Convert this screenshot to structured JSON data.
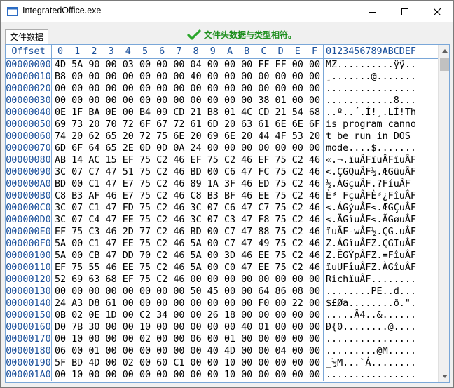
{
  "window": {
    "title": "IntegratedOffice.exe",
    "controls": {
      "minimize": "minimize-icon",
      "maximize": "maximize-icon",
      "close": "close-icon"
    }
  },
  "toolbar": {
    "tab_label": "文件数据",
    "status_text": "文件头数据与类型相符。",
    "status_icon": "checkmark-icon",
    "status_color": "#1f8f1f"
  },
  "hex_view": {
    "header": {
      "offset_label": "Offset",
      "columns": [
        "0",
        "1",
        "2",
        "3",
        "4",
        "5",
        "6",
        "7",
        "8",
        "9",
        "A",
        "B",
        "C",
        "D",
        "E",
        "F"
      ],
      "ascii_label": "0123456789ABCDEF"
    },
    "rows": [
      {
        "offset": "00000000",
        "bytes": [
          "4D",
          "5A",
          "90",
          "00",
          "03",
          "00",
          "00",
          "00",
          "04",
          "00",
          "00",
          "00",
          "FF",
          "FF",
          "00",
          "00"
        ],
        "ascii": "MZ..........ÿÿ.."
      },
      {
        "offset": "00000010",
        "bytes": [
          "B8",
          "00",
          "00",
          "00",
          "00",
          "00",
          "00",
          "00",
          "40",
          "00",
          "00",
          "00",
          "00",
          "00",
          "00",
          "00"
        ],
        "ascii": "¸.......@......."
      },
      {
        "offset": "00000020",
        "bytes": [
          "00",
          "00",
          "00",
          "00",
          "00",
          "00",
          "00",
          "00",
          "00",
          "00",
          "00",
          "00",
          "00",
          "00",
          "00",
          "00"
        ],
        "ascii": "................"
      },
      {
        "offset": "00000030",
        "bytes": [
          "00",
          "00",
          "00",
          "00",
          "00",
          "00",
          "00",
          "00",
          "00",
          "00",
          "00",
          "00",
          "38",
          "01",
          "00",
          "00"
        ],
        "ascii": "............8..."
      },
      {
        "offset": "00000040",
        "bytes": [
          "0E",
          "1F",
          "BA",
          "0E",
          "00",
          "B4",
          "09",
          "CD",
          "21",
          "B8",
          "01",
          "4C",
          "CD",
          "21",
          "54",
          "68"
        ],
        "ascii": "..º..´.Í!¸.LÍ!Th"
      },
      {
        "offset": "00000050",
        "bytes": [
          "69",
          "73",
          "20",
          "70",
          "72",
          "6F",
          "67",
          "72",
          "61",
          "6D",
          "20",
          "63",
          "61",
          "6E",
          "6E",
          "6F"
        ],
        "ascii": "is program canno"
      },
      {
        "offset": "00000060",
        "bytes": [
          "74",
          "20",
          "62",
          "65",
          "20",
          "72",
          "75",
          "6E",
          "20",
          "69",
          "6E",
          "20",
          "44",
          "4F",
          "53",
          "20"
        ],
        "ascii": "t be run in DOS "
      },
      {
        "offset": "00000070",
        "bytes": [
          "6D",
          "6F",
          "64",
          "65",
          "2E",
          "0D",
          "0D",
          "0A",
          "24",
          "00",
          "00",
          "00",
          "00",
          "00",
          "00",
          "00"
        ],
        "ascii": "mode....$......."
      },
      {
        "offset": "00000080",
        "bytes": [
          "AB",
          "14",
          "AC",
          "15",
          "EF",
          "75",
          "C2",
          "46",
          "EF",
          "75",
          "C2",
          "46",
          "EF",
          "75",
          "C2",
          "46"
        ],
        "ascii": "«.¬.ïuÂFïuÂFïuÂF"
      },
      {
        "offset": "00000090",
        "bytes": [
          "3C",
          "07",
          "C7",
          "47",
          "51",
          "75",
          "C2",
          "46",
          "BD",
          "00",
          "C6",
          "47",
          "FC",
          "75",
          "C2",
          "46"
        ],
        "ascii": "<.ÇGQuÂF½.ÆGüuÂF"
      },
      {
        "offset": "000000A0",
        "bytes": [
          "BD",
          "00",
          "C1",
          "47",
          "E7",
          "75",
          "C2",
          "46",
          "89",
          "1A",
          "3F",
          "46",
          "ED",
          "75",
          "C2",
          "46"
        ],
        "ascii": "½.ÁGçuÂF.?FíuÂF"
      },
      {
        "offset": "000000B0",
        "bytes": [
          "C8",
          "B3",
          "AF",
          "46",
          "E7",
          "75",
          "C2",
          "46",
          "C8",
          "B3",
          "BF",
          "46",
          "EE",
          "75",
          "C2",
          "46"
        ],
        "ascii": "È³¯FçuÂFÈ³¿FîuÂF"
      },
      {
        "offset": "000000C0",
        "bytes": [
          "3C",
          "07",
          "C1",
          "47",
          "FD",
          "75",
          "C2",
          "46",
          "3C",
          "07",
          "C6",
          "47",
          "C7",
          "75",
          "C2",
          "46"
        ],
        "ascii": "<.ÁGýuÂF<.ÆGÇuÂF"
      },
      {
        "offset": "000000D0",
        "bytes": [
          "3C",
          "07",
          "C4",
          "47",
          "EE",
          "75",
          "C2",
          "46",
          "3C",
          "07",
          "C3",
          "47",
          "F8",
          "75",
          "C2",
          "46"
        ],
        "ascii": "<.ÄGîuÂF<.ÃGøuÂF"
      },
      {
        "offset": "000000E0",
        "bytes": [
          "EF",
          "75",
          "C3",
          "46",
          "2D",
          "77",
          "C2",
          "46",
          "BD",
          "00",
          "C7",
          "47",
          "88",
          "75",
          "C2",
          "46"
        ],
        "ascii": "ïuÃF-wÂF½.ÇG.uÂF"
      },
      {
        "offset": "000000F0",
        "bytes": [
          "5A",
          "00",
          "C1",
          "47",
          "EE",
          "75",
          "C2",
          "46",
          "5A",
          "00",
          "C7",
          "47",
          "49",
          "75",
          "C2",
          "46"
        ],
        "ascii": "Z.ÁGîuÂFZ.ÇGIuÂF"
      },
      {
        "offset": "00000100",
        "bytes": [
          "5A",
          "00",
          "CB",
          "47",
          "DD",
          "70",
          "C2",
          "46",
          "5A",
          "00",
          "3D",
          "46",
          "EE",
          "75",
          "C2",
          "46"
        ],
        "ascii": "Z.ËGÝpÂFZ.=FîuÂF"
      },
      {
        "offset": "00000110",
        "bytes": [
          "EF",
          "75",
          "55",
          "46",
          "EE",
          "75",
          "C2",
          "46",
          "5A",
          "00",
          "C0",
          "47",
          "EE",
          "75",
          "C2",
          "46"
        ],
        "ascii": "ïuUFîuÂFZ.ÀGîuÂF"
      },
      {
        "offset": "00000120",
        "bytes": [
          "52",
          "69",
          "63",
          "68",
          "EF",
          "75",
          "C2",
          "46",
          "00",
          "00",
          "00",
          "00",
          "00",
          "00",
          "00",
          "00"
        ],
        "ascii": "RichïuÂF........"
      },
      {
        "offset": "00000130",
        "bytes": [
          "00",
          "00",
          "00",
          "00",
          "00",
          "00",
          "00",
          "00",
          "50",
          "45",
          "00",
          "00",
          "64",
          "86",
          "08",
          "00"
        ],
        "ascii": "........PE..d..."
      },
      {
        "offset": "00000140",
        "bytes": [
          "24",
          "A3",
          "D8",
          "61",
          "00",
          "00",
          "00",
          "00",
          "00",
          "00",
          "00",
          "00",
          "F0",
          "00",
          "22",
          "00"
        ],
        "ascii": "$£Øa........ð.\"."
      },
      {
        "offset": "00000150",
        "bytes": [
          "0B",
          "02",
          "0E",
          "1D",
          "00",
          "C2",
          "34",
          "00",
          "00",
          "26",
          "18",
          "00",
          "00",
          "00",
          "00",
          "00"
        ],
        "ascii": ".....Â4..&......"
      },
      {
        "offset": "00000160",
        "bytes": [
          "D0",
          "7B",
          "30",
          "00",
          "00",
          "10",
          "00",
          "00",
          "00",
          "00",
          "00",
          "40",
          "01",
          "00",
          "00",
          "00"
        ],
        "ascii": "Ð{0........@...."
      },
      {
        "offset": "00000170",
        "bytes": [
          "00",
          "10",
          "00",
          "00",
          "00",
          "02",
          "00",
          "00",
          "06",
          "00",
          "01",
          "00",
          "00",
          "00",
          "00",
          "00"
        ],
        "ascii": "................"
      },
      {
        "offset": "00000180",
        "bytes": [
          "06",
          "00",
          "01",
          "00",
          "00",
          "00",
          "00",
          "00",
          "00",
          "40",
          "4D",
          "00",
          "00",
          "04",
          "00",
          "00"
        ],
        "ascii": ".........@M....."
      },
      {
        "offset": "00000190",
        "bytes": [
          "5F",
          "BD",
          "4D",
          "00",
          "02",
          "00",
          "60",
          "C1",
          "00",
          "00",
          "10",
          "00",
          "00",
          "00",
          "00",
          "00"
        ],
        "ascii": "_½M...`Á........"
      },
      {
        "offset": "000001A0",
        "bytes": [
          "00",
          "10",
          "00",
          "00",
          "00",
          "00",
          "00",
          "00",
          "00",
          "00",
          "10",
          "00",
          "00",
          "00",
          "00",
          "00"
        ],
        "ascii": "................"
      }
    ]
  }
}
